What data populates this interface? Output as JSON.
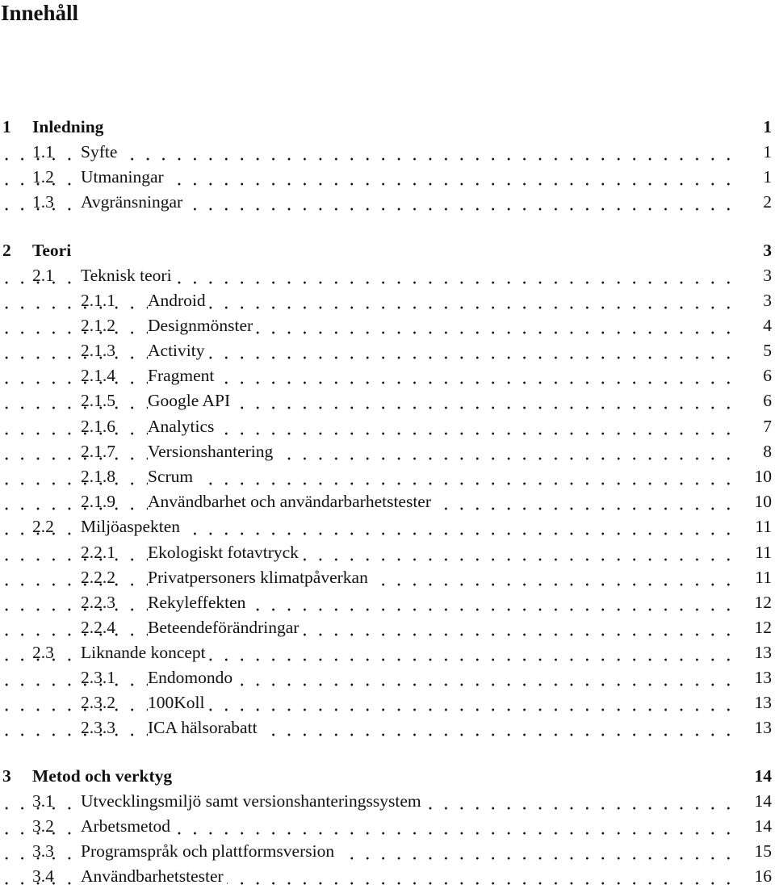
{
  "document": {
    "toc_title": "Innehåll",
    "chapters": [
      {
        "number": "1",
        "title": "Inledning",
        "page": "1",
        "sections": [
          {
            "number": "1.1",
            "title": "Syfte",
            "page": "1",
            "subsections": []
          },
          {
            "number": "1.2",
            "title": "Utmaningar",
            "page": "1",
            "subsections": []
          },
          {
            "number": "1.3",
            "title": "Avgränsningar",
            "page": "2",
            "subsections": []
          }
        ]
      },
      {
        "number": "2",
        "title": "Teori",
        "page": "3",
        "sections": [
          {
            "number": "2.1",
            "title": "Teknisk teori",
            "page": "3",
            "subsections": [
              {
                "number": "2.1.1",
                "title": "Android",
                "page": "3"
              },
              {
                "number": "2.1.2",
                "title": "Designmönster",
                "page": "4"
              },
              {
                "number": "2.1.3",
                "title": "Activity",
                "page": "5"
              },
              {
                "number": "2.1.4",
                "title": "Fragment",
                "page": "6"
              },
              {
                "number": "2.1.5",
                "title": "Google API",
                "page": "6"
              },
              {
                "number": "2.1.6",
                "title": "Analytics",
                "page": "7"
              },
              {
                "number": "2.1.7",
                "title": "Versionshantering",
                "page": "8"
              },
              {
                "number": "2.1.8",
                "title": "Scrum",
                "page": "10"
              },
              {
                "number": "2.1.9",
                "title": "Användbarhet och användarbarhetstester",
                "page": "10"
              }
            ]
          },
          {
            "number": "2.2",
            "title": "Miljöaspekten",
            "page": "11",
            "subsections": [
              {
                "number": "2.2.1",
                "title": "Ekologiskt fotavtryck",
                "page": "11"
              },
              {
                "number": "2.2.2",
                "title": "Privatpersoners klimatpåverkan",
                "page": "11"
              },
              {
                "number": "2.2.3",
                "title": "Rekyleffekten",
                "page": "12"
              },
              {
                "number": "2.2.4",
                "title": "Beteendeförändringar",
                "page": "12"
              }
            ]
          },
          {
            "number": "2.3",
            "title": "Liknande koncept",
            "page": "13",
            "subsections": [
              {
                "number": "2.3.1",
                "title": "Endomondo",
                "page": "13"
              },
              {
                "number": "2.3.2",
                "title": "100Koll",
                "page": "13"
              },
              {
                "number": "2.3.3",
                "title": "ICA hälsorabatt",
                "page": "13"
              }
            ]
          }
        ]
      },
      {
        "number": "3",
        "title": "Metod och verktyg",
        "page": "14",
        "sections": [
          {
            "number": "3.1",
            "title": "Utvecklingsmiljö samt versionshanteringssystem",
            "page": "14",
            "subsections": []
          },
          {
            "number": "3.2",
            "title": "Arbetsmetod",
            "page": "14",
            "subsections": []
          },
          {
            "number": "3.3",
            "title": "Programspråk och plattformsversion",
            "page": "15",
            "subsections": []
          },
          {
            "number": "3.4",
            "title": "Användbarhetstester",
            "page": "16",
            "subsections": []
          }
        ]
      }
    ]
  }
}
